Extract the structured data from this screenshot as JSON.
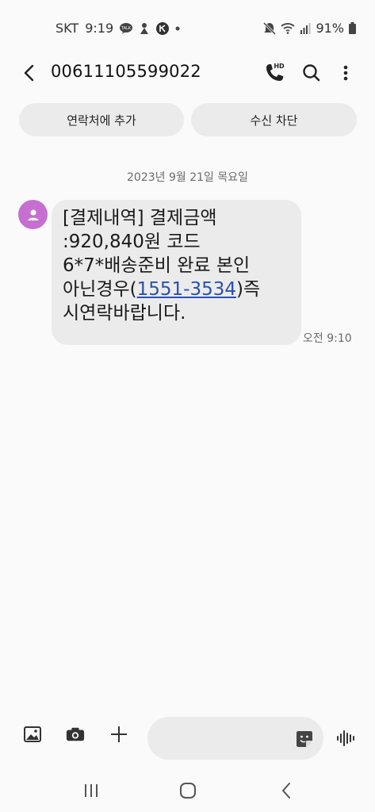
{
  "status_bar": {
    "carrier": "SKT",
    "time": "9:19",
    "battery": "91%",
    "left_icons": [
      "talk-icon",
      "notification-icon",
      "app-icon",
      "dot-icon"
    ],
    "right_icons": [
      "mute-icon",
      "wifi-icon",
      "signal-icon",
      "battery-icon"
    ]
  },
  "header": {
    "title": "00611105599022",
    "icons": [
      "back-icon",
      "hd-call-icon",
      "search-icon",
      "more-icon"
    ]
  },
  "actions": {
    "add_contact": "연락처에 추가",
    "block": "수신 차단"
  },
  "date_separator": "2023년 9월 21일 목요일",
  "message": {
    "lines": [
      "[결제내역] 결제금액",
      ":920,840원 코드",
      "6*7*배송준비 완료 본인"
    ],
    "line4_prefix": "아닌경우(",
    "line4_link": "1551-3534",
    "line4_suffix": ")즉",
    "line5": "시연락바랍니다.",
    "time": "오전 9:10"
  },
  "composer": {
    "placeholder": "",
    "icons": [
      "gallery-icon",
      "camera-icon",
      "plus-icon",
      "sticker-icon",
      "voice-icon"
    ]
  },
  "colors": {
    "background": "#fafafa",
    "bubble": "#ebebeb",
    "chip": "#ebebeb",
    "avatar": "#c66fd0",
    "link": "#2a4fb0"
  }
}
